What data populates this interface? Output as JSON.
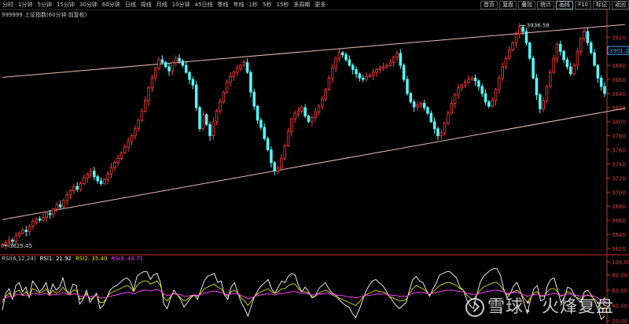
{
  "toolbar": {
    "periods": [
      "分时",
      "1分钟",
      "5分钟",
      "15分钟",
      "30分钟",
      "60分钟",
      "日线",
      "周线",
      "月线",
      "10分钟",
      "45日线",
      "季线",
      "年线",
      "1秒",
      "5秒",
      "15秒",
      "多周期",
      "更多"
    ],
    "right": [
      {
        "label": "首页",
        "active": false
      },
      {
        "label": "复盘",
        "active": false
      },
      {
        "label": "叠加",
        "active": false
      },
      {
        "label": "统计",
        "active": false
      },
      {
        "label": "画线",
        "active": true
      },
      {
        "label": "F10",
        "active": false
      },
      {
        "label": "标记",
        "active": false
      },
      {
        "label": "返回",
        "active": false
      }
    ]
  },
  "header": {
    "title": "999999 上证指数(60分钟 前复权)"
  },
  "indicator": {
    "name": "RSI(6,12,24)",
    "rsi1": "RSI1: 21.92",
    "rsi2": "RSI2: 35.40",
    "rsi3": "RSI3: 43.71"
  },
  "watermark": {
    "text": "雪球：火烽复盘"
  },
  "colors": {
    "up": "#ff3d3d",
    "down": "#54ffff",
    "trend": "#f2b8b8",
    "rsi1": "#ffffff",
    "rsi2": "#e6e600",
    "rsi3": "#ff3cff",
    "axis": "#d03030",
    "background": "#000000"
  },
  "chart_data": [
    {
      "type": "candlestick",
      "title": "999999 上证指数(60分钟 前复权)",
      "ylim": [
        3611,
        3946
      ],
      "yticks": [
        3620,
        3640,
        3660,
        3680,
        3700,
        3720,
        3740,
        3760,
        3780,
        3800,
        3820,
        3840,
        3860,
        3880,
        3900,
        3920
      ],
      "last_price_label": "3901.2",
      "annotations": [
        {
          "label": "3625.45",
          "value": 3625.45
        },
        {
          "label": "3936.58",
          "value": 3936.58
        }
      ],
      "trendlines": [
        {
          "from": [
            0,
            3863
          ],
          "to": [
            183,
            3938
          ]
        },
        {
          "from": [
            0,
            3661
          ],
          "to": [
            183,
            3819
          ]
        }
      ],
      "close": [
        3625.45,
        3628,
        3632,
        3630,
        3638,
        3642,
        3646,
        3644,
        3652,
        3658,
        3662,
        3660,
        3664,
        3670,
        3668,
        3676,
        3682,
        3679,
        3688,
        3696,
        3702,
        3708,
        3704,
        3712,
        3720,
        3726,
        3730,
        3722,
        3716,
        3712,
        3718,
        3726,
        3735,
        3742,
        3748,
        3756,
        3764,
        3772,
        3780,
        3790,
        3802,
        3815,
        3830,
        3848,
        3862,
        3876,
        3888,
        3884,
        3878,
        3872,
        3884,
        3890,
        3886,
        3880,
        3870,
        3860,
        3852,
        3820,
        3790,
        3810,
        3796,
        3780,
        3800,
        3815,
        3828,
        3842,
        3856,
        3864,
        3870,
        3876,
        3880,
        3884,
        3870,
        3842,
        3822,
        3802,
        3792,
        3776,
        3760,
        3742,
        3730,
        3734,
        3748,
        3766,
        3786,
        3804,
        3812,
        3815,
        3820,
        3808,
        3800,
        3806,
        3814,
        3822,
        3832,
        3846,
        3862,
        3876,
        3890,
        3898,
        3895,
        3888,
        3880,
        3874,
        3868,
        3862,
        3860,
        3864,
        3866,
        3870,
        3874,
        3876,
        3878,
        3880,
        3884,
        3892,
        3897,
        3880,
        3860,
        3840,
        3828,
        3821,
        3824,
        3826,
        3820,
        3812,
        3800,
        3790,
        3780,
        3784,
        3798,
        3812,
        3826,
        3838,
        3848,
        3852,
        3856,
        3860,
        3862,
        3858,
        3850,
        3840,
        3828,
        3822,
        3830,
        3846,
        3862,
        3878,
        3890,
        3902,
        3912,
        3924,
        3934,
        3928,
        3912,
        3890,
        3862,
        3838,
        3818,
        3830,
        3850,
        3870,
        3890,
        3910,
        3900,
        3888,
        3878,
        3868,
        3880,
        3900,
        3918,
        3928,
        3912,
        3898,
        3880,
        3862,
        3850,
        3840
      ]
    },
    {
      "type": "line",
      "title": "RSI(6,12,24)",
      "ylim": [
        20,
        100
      ],
      "yticks": [
        20,
        40,
        60,
        80,
        100
      ],
      "series": [
        {
          "name": "RSI1",
          "values": [
            34,
            56,
            62,
            48,
            66,
            70,
            58,
            64,
            50,
            72,
            66,
            58,
            62,
            70,
            54,
            68,
            60,
            64,
            76,
            60,
            56,
            68,
            66,
            42,
            48,
            60,
            44,
            50,
            56,
            36,
            40,
            50,
            60,
            64,
            66,
            70,
            74,
            76,
            72,
            60,
            78,
            82,
            84,
            84,
            74,
            80,
            82,
            70,
            42,
            36,
            50,
            60,
            54,
            48,
            38,
            44,
            50,
            54,
            48,
            60,
            72,
            78,
            80,
            82,
            70,
            72,
            54,
            48,
            64,
            70,
            56,
            44,
            36,
            26,
            40,
            52,
            60,
            66,
            70,
            74,
            62,
            56,
            64,
            72,
            70,
            78,
            82,
            80,
            66,
            58,
            64,
            58,
            50,
            52,
            62,
            66,
            70,
            62,
            56,
            54,
            48,
            44,
            40,
            38,
            30,
            24,
            34,
            46,
            58,
            66,
            72,
            74,
            70,
            66,
            60,
            52,
            46,
            40,
            36,
            40,
            44,
            60,
            74,
            78,
            72,
            70,
            60,
            52,
            62,
            70,
            80,
            82,
            84,
            84,
            80,
            76,
            64,
            60,
            48,
            40,
            36,
            54,
            70,
            78,
            82,
            86,
            88,
            88,
            80,
            62,
            50,
            56,
            66,
            70,
            58,
            44,
            30,
            48,
            62,
            66,
            46,
            48,
            66,
            74,
            76,
            60,
            44,
            50,
            64,
            62,
            54,
            48,
            44,
            58,
            60,
            54,
            46,
            36,
            22,
            26
          ]
        },
        {
          "name": "RSI2",
          "values": [
            44,
            52,
            56,
            50,
            58,
            60,
            54,
            58,
            52,
            62,
            60,
            56,
            58,
            62,
            54,
            60,
            56,
            58,
            64,
            58,
            54,
            60,
            60,
            48,
            50,
            56,
            48,
            50,
            54,
            44,
            44,
            50,
            56,
            58,
            60,
            62,
            64,
            66,
            64,
            58,
            66,
            70,
            72,
            72,
            68,
            70,
            72,
            66,
            50,
            46,
            52,
            56,
            54,
            50,
            46,
            48,
            52,
            54,
            52,
            56,
            62,
            64,
            66,
            68,
            64,
            62,
            56,
            52,
            58,
            60,
            56,
            50,
            46,
            40,
            46,
            52,
            56,
            58,
            60,
            62,
            58,
            56,
            58,
            62,
            62,
            66,
            68,
            68,
            62,
            58,
            58,
            56,
            52,
            52,
            56,
            58,
            60,
            58,
            54,
            52,
            50,
            48,
            46,
            44,
            42,
            40,
            44,
            50,
            54,
            56,
            58,
            60,
            58,
            58,
            56,
            52,
            50,
            48,
            46,
            46,
            48,
            56,
            62,
            66,
            64,
            62,
            58,
            54,
            58,
            62,
            66,
            68,
            70,
            70,
            68,
            66,
            62,
            60,
            54,
            50,
            48,
            54,
            60,
            64,
            66,
            68,
            70,
            70,
            66,
            60,
            54,
            56,
            58,
            60,
            56,
            50,
            44,
            50,
            56,
            58,
            52,
            52,
            58,
            62,
            62,
            58,
            52,
            54,
            58,
            56,
            52,
            50,
            48,
            52,
            54,
            52,
            48,
            44,
            36,
            35.4
          ]
        },
        {
          "name": "RSI3",
          "values": [
            48,
            50,
            52,
            50,
            54,
            55,
            53,
            54,
            52,
            56,
            56,
            54,
            55,
            56,
            53,
            55,
            54,
            55,
            57,
            55,
            54,
            55,
            55,
            52,
            52,
            53,
            51,
            52,
            53,
            50,
            50,
            51,
            52,
            53,
            54,
            55,
            56,
            57,
            57,
            55,
            57,
            59,
            60,
            60,
            59,
            60,
            61,
            59,
            55,
            53,
            54,
            55,
            55,
            54,
            52,
            52,
            53,
            54,
            53,
            54,
            56,
            57,
            58,
            59,
            58,
            57,
            55,
            54,
            55,
            56,
            55,
            53,
            51,
            49,
            50,
            52,
            53,
            54,
            55,
            55,
            55,
            54,
            55,
            56,
            56,
            57,
            58,
            58,
            57,
            56,
            56,
            55,
            54,
            54,
            55,
            55,
            56,
            56,
            55,
            54,
            53,
            53,
            52,
            51,
            51,
            50,
            51,
            52,
            53,
            53,
            54,
            55,
            55,
            55,
            55,
            54,
            53,
            53,
            52,
            52,
            52,
            54,
            56,
            57,
            57,
            57,
            56,
            55,
            56,
            57,
            58,
            59,
            60,
            60,
            60,
            59,
            58,
            58,
            56,
            55,
            54,
            55,
            56,
            57,
            58,
            59,
            60,
            60,
            59,
            58,
            56,
            56,
            57,
            57,
            56,
            54,
            52,
            53,
            54,
            55,
            53,
            53,
            54,
            55,
            56,
            55,
            53,
            54,
            55,
            55,
            54,
            53,
            52,
            53,
            53,
            53,
            52,
            50,
            46,
            43.71
          ]
        }
      ]
    }
  ]
}
